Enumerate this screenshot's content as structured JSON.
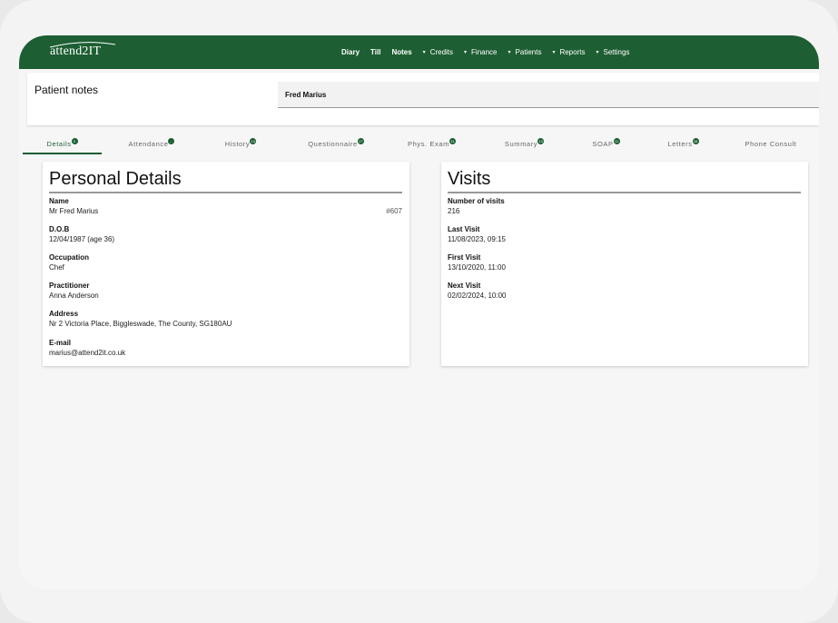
{
  "app": {
    "logo_text": "attend2IT",
    "nav": [
      {
        "label": "Diary",
        "caret": false
      },
      {
        "label": "Till",
        "caret": false
      },
      {
        "label": "Notes",
        "caret": false
      },
      {
        "label": "Credits",
        "caret": true
      },
      {
        "label": "Finance",
        "caret": true
      },
      {
        "label": "Patients",
        "caret": true
      },
      {
        "label": "Reports",
        "caret": true
      },
      {
        "label": "Settings",
        "caret": true
      }
    ],
    "brand_color": "#1d5e33"
  },
  "header": {
    "title": "Patient notes",
    "patient_name": "Fred Marius"
  },
  "tabs": [
    {
      "label": "Details",
      "badge": "0",
      "active": true
    },
    {
      "label": "Attendance",
      "badge": "...",
      "active": false
    },
    {
      "label": "History",
      "badge": "14",
      "active": false
    },
    {
      "label": "Questionnaire",
      "badge": "17",
      "active": false
    },
    {
      "label": "Phys. Exam",
      "badge": "11",
      "active": false
    },
    {
      "label": "Summary",
      "badge": "13",
      "active": false
    },
    {
      "label": "SOAP",
      "badge": "11",
      "active": false
    },
    {
      "label": "Letters",
      "badge": "15",
      "active": false
    },
    {
      "label": "Phone Consult",
      "badge": "",
      "active": false
    }
  ],
  "personal_details": {
    "title": "Personal Details",
    "patient_id": "#607",
    "fields": [
      {
        "label": "Name",
        "value": "Mr Fred Marius"
      },
      {
        "label": "D.O.B",
        "value": "12/04/1987 (age 36)"
      },
      {
        "label": "Occupation",
        "value": "Chef"
      },
      {
        "label": "Practitioner",
        "value": "Anna Anderson"
      },
      {
        "label": "Address",
        "value": "Nr 2 Victoria Place, Biggleswade, The County, SG180AU"
      },
      {
        "label": "E-mail",
        "value": "marius@attend2it.co.uk"
      }
    ]
  },
  "visits": {
    "title": "Visits",
    "fields": [
      {
        "label": "Number of visits",
        "value": "216"
      },
      {
        "label": "Last Visit",
        "value": "11/08/2023, 09:15"
      },
      {
        "label": "First Visit",
        "value": "13/10/2020, 11:00"
      },
      {
        "label": "Next Visit",
        "value": "02/02/2024, 10:00"
      }
    ]
  }
}
